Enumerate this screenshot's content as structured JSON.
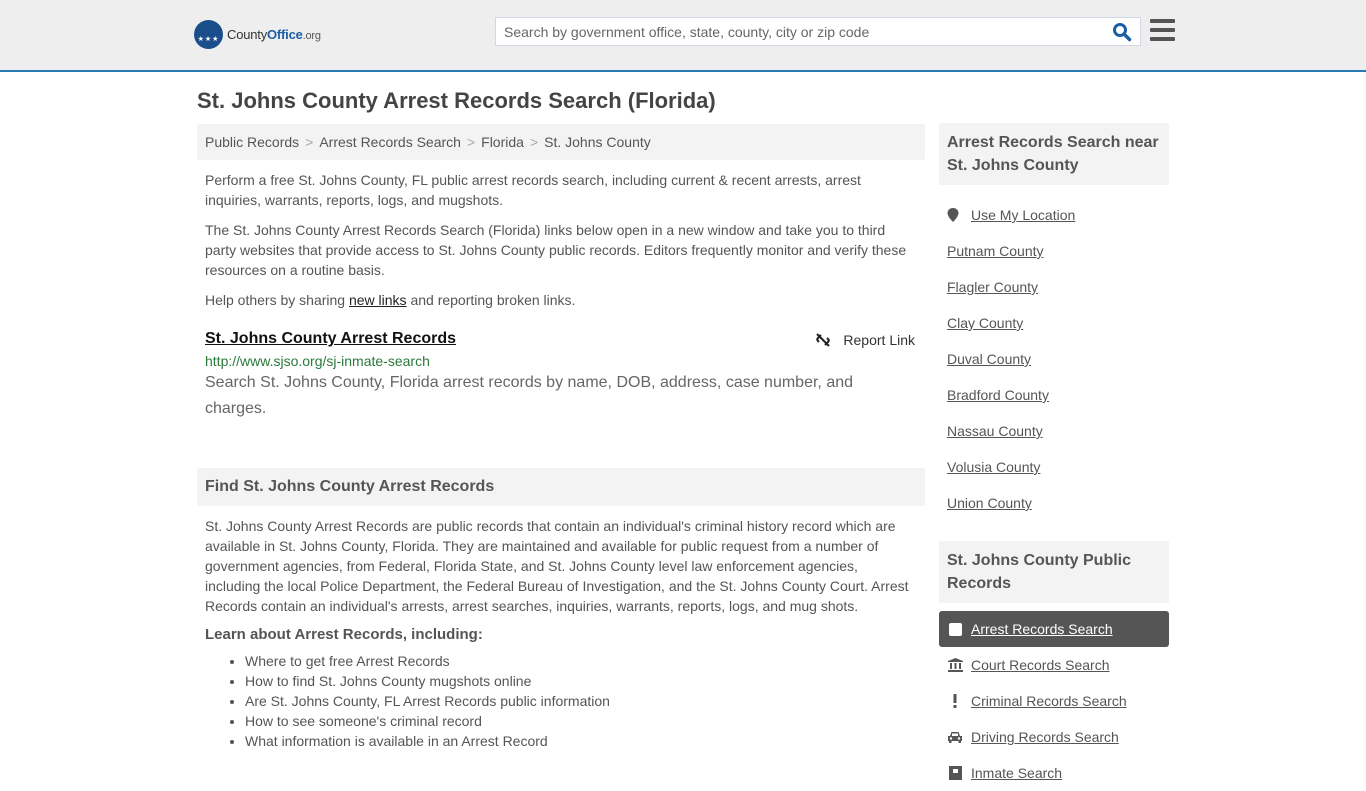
{
  "header": {
    "logo": {
      "brand_a": "County",
      "brand_b": "Office",
      "brand_c": ".org"
    },
    "search": {
      "placeholder": "Search by government office, state, county, city or zip code",
      "value": ""
    },
    "colors": {
      "accent": "#2a79b5",
      "logo_blue": "#1b4f8c"
    }
  },
  "page_title": "St. Johns County Arrest Records Search (Florida)",
  "breadcrumb": [
    "Public Records",
    "Arrest Records Search",
    "Florida",
    "St. Johns County"
  ],
  "intro": {
    "p1": "Perform a free St. Johns County, FL public arrest records search, including current & recent arrests, arrest inquiries, warrants, reports, logs, and mugshots.",
    "p2": "The St. Johns County Arrest Records Search (Florida) links below open in a new window and take you to third party websites that provide access to St. Johns County public records. Editors frequently monitor and verify these resources on a routine basis.",
    "p3_before": "Help others by sharing ",
    "p3_link": "new links",
    "p3_after": " and reporting broken links."
  },
  "result": {
    "title": "St. Johns County Arrest Records",
    "report_label": "Report Link",
    "url": "http://www.sjso.org/sj-inmate-search",
    "description": "Search St. Johns County, Florida arrest records by name, DOB, address, case number, and charges."
  },
  "find_section": {
    "heading": "Find St. Johns County Arrest Records",
    "body": "St. Johns County Arrest Records are public records that contain an individual's criminal history record which are available in St. Johns County, Florida. They are maintained and available for public request from a number of government agencies, from Federal, Florida State, and St. Johns County level law enforcement agencies, including the local Police Department, the Federal Bureau of Investigation, and the St. Johns County Court. Arrest Records contain an individual's arrests, arrest searches, inquiries, warrants, reports, logs, and mug shots.",
    "learn_heading": "Learn about Arrest Records, including:",
    "bullets": [
      "Where to get free Arrest Records",
      "How to find St. Johns County mugshots online",
      "Are St. Johns County, FL Arrest Records public information",
      "How to see someone's criminal record",
      "What information is available in an Arrest Record"
    ]
  },
  "sidebar": {
    "nearby_heading": "Arrest Records Search near St. Johns County",
    "use_location": "Use My Location",
    "nearby": [
      "Putnam County",
      "Flagler County",
      "Clay County",
      "Duval County",
      "Bradford County",
      "Nassau County",
      "Volusia County",
      "Union County"
    ],
    "public_heading": "St. Johns County Public Records",
    "records": [
      {
        "label": "Arrest Records Search",
        "icon": "square-icon",
        "active": true
      },
      {
        "label": "Court Records Search",
        "icon": "courthouse-icon",
        "active": false
      },
      {
        "label": "Criminal Records Search",
        "icon": "exclamation-icon",
        "active": false
      },
      {
        "label": "Driving Records Search",
        "icon": "car-icon",
        "active": false
      },
      {
        "label": "Inmate Search",
        "icon": "inmate-icon",
        "active": false
      }
    ]
  }
}
